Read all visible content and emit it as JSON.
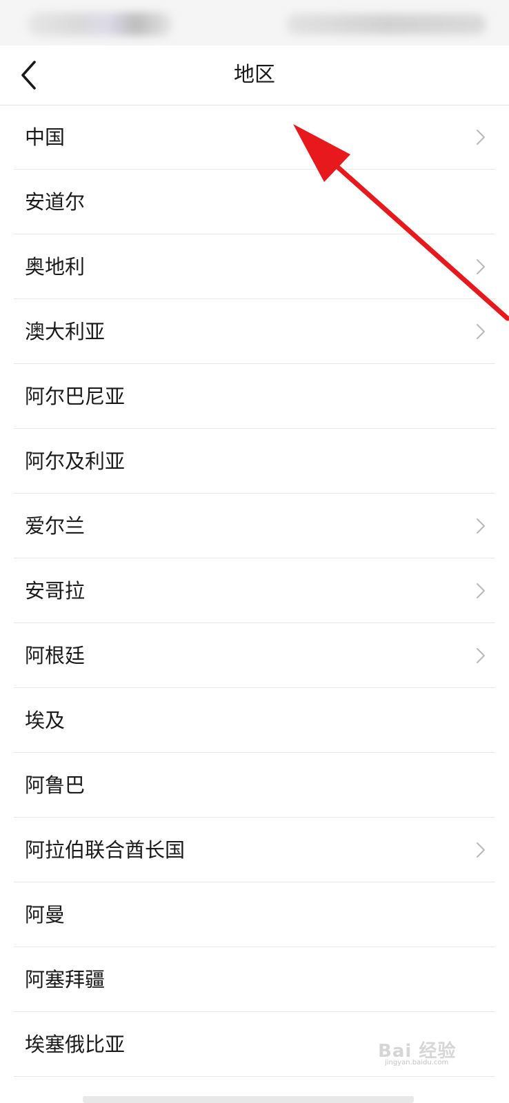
{
  "header": {
    "title": "地区",
    "back_icon": "chevron-left-icon"
  },
  "regions": [
    {
      "name": "中国",
      "has_submenu": true
    },
    {
      "name": "安道尔",
      "has_submenu": false
    },
    {
      "name": "奥地利",
      "has_submenu": true
    },
    {
      "name": "澳大利亚",
      "has_submenu": true
    },
    {
      "name": "阿尔巴尼亚",
      "has_submenu": false
    },
    {
      "name": "阿尔及利亚",
      "has_submenu": false
    },
    {
      "name": "爱尔兰",
      "has_submenu": true
    },
    {
      "name": "安哥拉",
      "has_submenu": true
    },
    {
      "name": "阿根廷",
      "has_submenu": true
    },
    {
      "name": "埃及",
      "has_submenu": false
    },
    {
      "name": "阿鲁巴",
      "has_submenu": false
    },
    {
      "name": "阿拉伯联合酋长国",
      "has_submenu": true
    },
    {
      "name": "阿曼",
      "has_submenu": false
    },
    {
      "name": "阿塞拜疆",
      "has_submenu": false
    },
    {
      "name": "埃塞俄比亚",
      "has_submenu": false
    }
  ],
  "annotation": {
    "type": "arrow",
    "color": "#e8191c"
  },
  "watermark": {
    "text": "Bai 经验",
    "subtext": "jingyan.baidu.com"
  },
  "colors": {
    "background": "#ffffff",
    "text": "#1a1a1a",
    "divider": "#e6e6e6",
    "chevron": "#b8b8b8",
    "annotation": "#e8191c"
  }
}
